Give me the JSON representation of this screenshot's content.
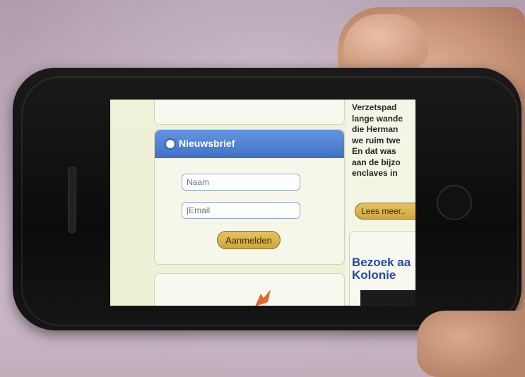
{
  "newsletter": {
    "title": "Nieuwsbrief",
    "name_placeholder": "Naam",
    "email_placeholder": "|Email",
    "submit_label": "Aanmelden"
  },
  "article": {
    "lines": [
      "Verzetspad",
      "lange wande",
      "die Herman",
      "we ruim twe",
      "En dat was",
      "aan de bijzo",
      "enclaves in"
    ],
    "read_more_label": "Lees meer.."
  },
  "sidebar_card": {
    "title_line1": "Bezoek aa",
    "title_line2": "Kolonie"
  },
  "colors": {
    "header_blue": "#4a7fd6",
    "button_gold": "#d9b24a",
    "link_blue": "#1f4aa8",
    "screen_bg": "#eef1d6"
  }
}
